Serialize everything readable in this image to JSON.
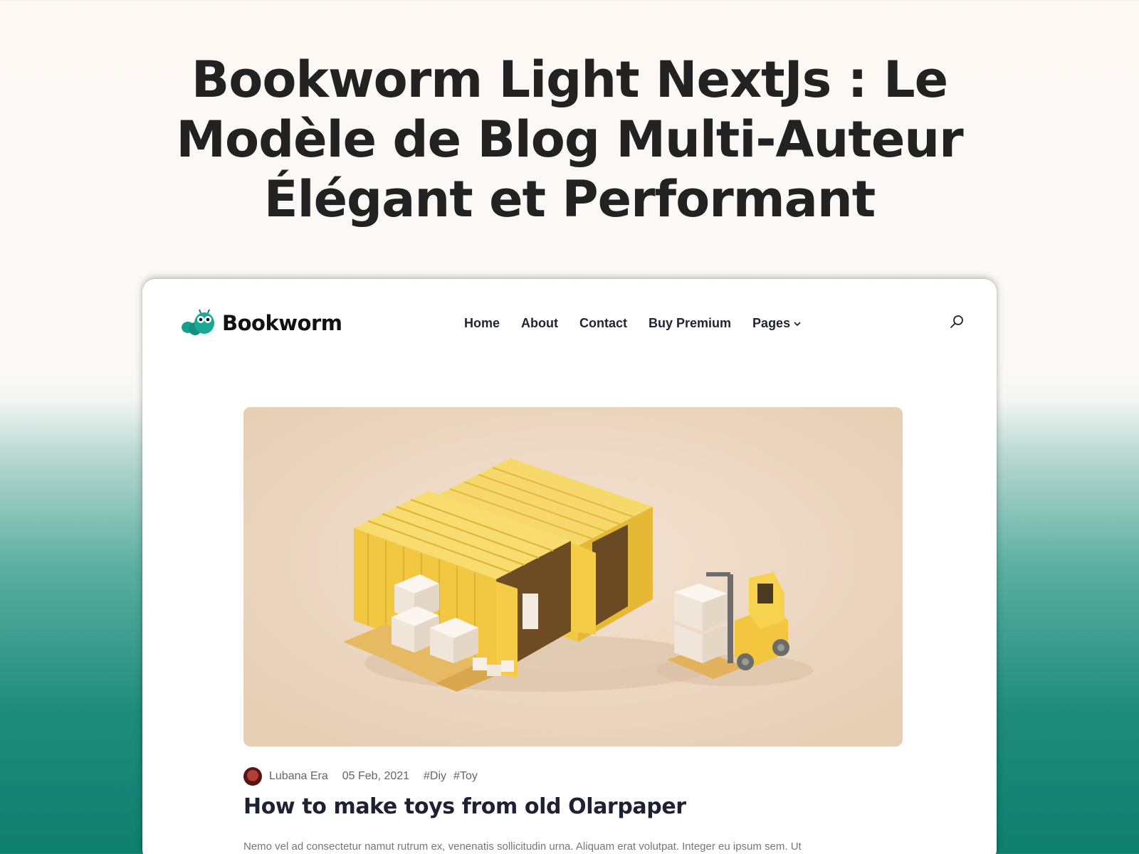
{
  "hero": {
    "title": "Bookworm Light NextJs : Le Modèle de Blog Multi-Auteur Élégant et Performant"
  },
  "site": {
    "logo_text": "Bookworm",
    "brand_color": "#1a9b8c"
  },
  "nav": {
    "items": [
      {
        "label": "Home"
      },
      {
        "label": "About"
      },
      {
        "label": "Contact"
      },
      {
        "label": "Buy Premium"
      },
      {
        "label": "Pages"
      }
    ],
    "search_icon": "search-icon"
  },
  "post": {
    "author": "Lubana Era",
    "date": "05 Feb, 2021",
    "tags": [
      "#Diy",
      "#Toy"
    ],
    "title": "How to make toys from old Olarpaper",
    "excerpt": "Nemo vel ad consectetur namut rutrum ex, venenatis sollicitudin urna. Aliquam erat volutpat. Integer eu ipsum sem. Ut"
  },
  "colors": {
    "container_yellow": "#f3c94a",
    "image_bg": "#ecd6c0",
    "title_text": "#222222"
  }
}
